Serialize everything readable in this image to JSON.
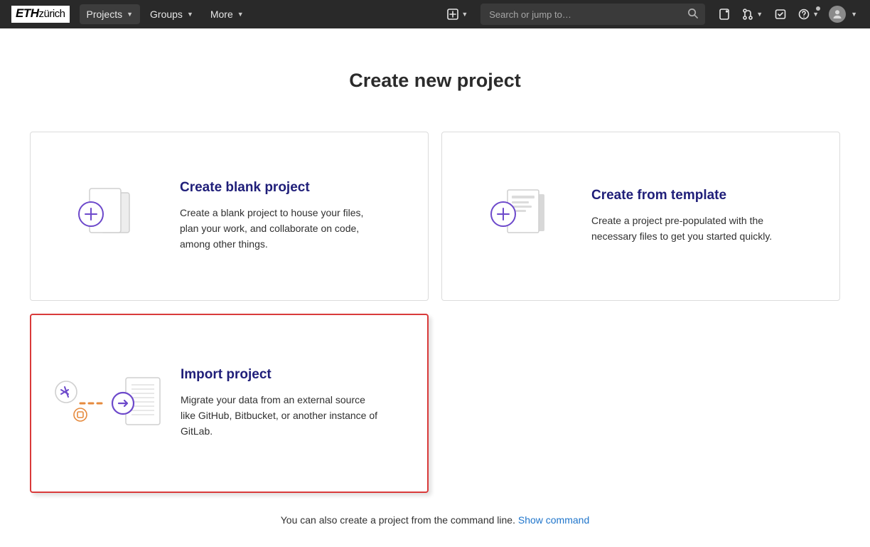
{
  "header": {
    "brand_bold": "ETH",
    "brand_rest": "zürich",
    "nav": {
      "projects": "Projects",
      "groups": "Groups",
      "more": "More"
    },
    "search_placeholder": "Search or jump to…"
  },
  "page": {
    "title": "Create new project"
  },
  "cards": {
    "blank": {
      "title": "Create blank project",
      "desc": "Create a blank project to house your files, plan your work, and collaborate on code, among other things."
    },
    "template": {
      "title": "Create from template",
      "desc": "Create a project pre-populated with the necessary files to get you started quickly."
    },
    "import": {
      "title": "Import project",
      "desc": "Migrate your data from an external source like GitHub, Bitbucket, or another instance of GitLab."
    }
  },
  "footer": {
    "text": "You can also create a project from the command line. ",
    "link": "Show command"
  }
}
